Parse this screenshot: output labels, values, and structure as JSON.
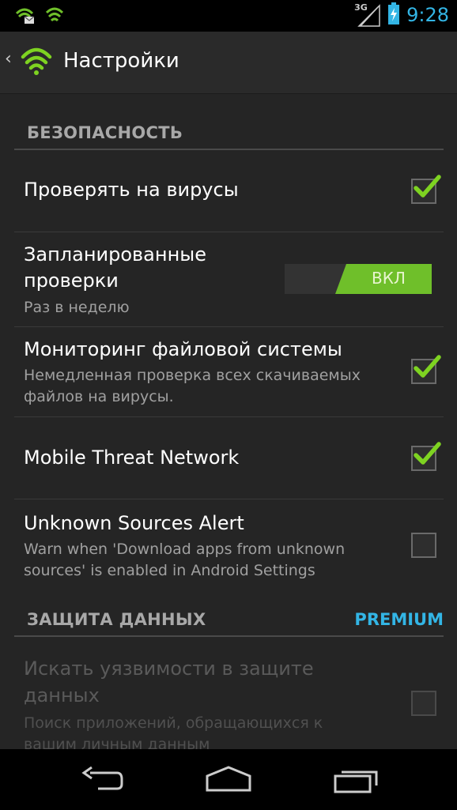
{
  "status_bar": {
    "time": "9:28",
    "network": "3G",
    "icons": [
      "lookout-notification-icon",
      "lookout-shield-icon",
      "signal-icon",
      "battery-charging-icon"
    ]
  },
  "action_bar": {
    "title": "Настройки",
    "icon": "lookout-logo-icon"
  },
  "sections": {
    "security": {
      "header": "БЕЗОПАСНОСТЬ"
    },
    "data_protection": {
      "header": "ЗАЩИТА ДАННЫХ",
      "badge": "PREMIUM"
    }
  },
  "prefs": {
    "virus_scan": {
      "title": "Проверять на вирусы",
      "checked": true
    },
    "scheduled": {
      "title_line1": "Запланированные",
      "title_line2": "проверки",
      "summary": "Раз в неделю",
      "toggle": "ВКЛ"
    },
    "fs_monitor": {
      "title": "Мониторинг файловой системы",
      "summary_line1": "Немедленная проверка всех скачиваемых",
      "summary_line2": "файлов на вирусы.",
      "checked": true
    },
    "mtn": {
      "title": "Mobile Threat Network",
      "checked": true
    },
    "unknown_sources": {
      "title": "Unknown Sources Alert",
      "summary_line1": "Warn when 'Download apps from unknown",
      "summary_line2": "sources' is enabled in Android Settings",
      "checked": false
    },
    "privacy_scan": {
      "title_line1": "Искать уязвимости в защите",
      "title_line2": "данных",
      "summary_line1": "Поиск приложений, обращающихся к",
      "summary_line2": "вашим личным данным",
      "checked": false,
      "enabled": false
    }
  },
  "nav_bar": {
    "back": "back-icon",
    "home": "home-icon",
    "recents": "recents-icon"
  },
  "colors": {
    "accent": "#33b5e5",
    "check_green": "#7ed321",
    "toggle_green": "#6fbf2a"
  }
}
